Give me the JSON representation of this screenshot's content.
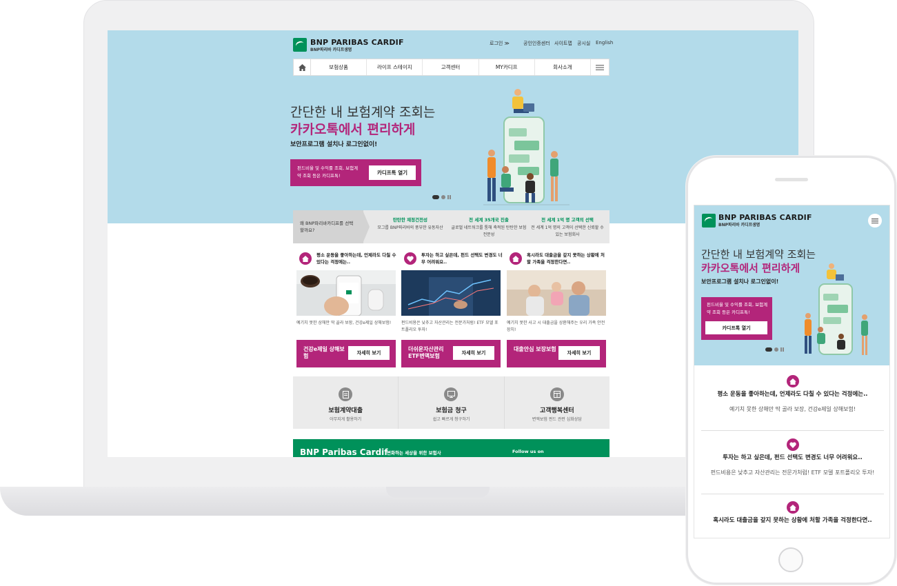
{
  "desktop": {
    "logo": {
      "main": "BNP PARIBAS CARDIF",
      "sub": "BNP파리바 카디프생명"
    },
    "util_links": [
      "로그인 ≫",
      "공인인증센터",
      "사이트맵",
      "공시실",
      "English"
    ],
    "nav": [
      "보험상품",
      "라이프 스테이지",
      "고객센터",
      "MY카디프",
      "회사소개"
    ],
    "hero": {
      "line1": "간단한 내 보험계약 조회는",
      "line2": "카카오톡에서 편리하게",
      "line3": "보안프로그램 설치나 로그인없이!",
      "promo_text": "펀드비율 및 수익률 조회, 보험계약 조회 등은 카디프톡!",
      "promo_button": "카디프톡 열기"
    },
    "why": {
      "lead": "왜 BNP파리바카디프를 선택할까요?",
      "cols": [
        {
          "title": "탄탄한 재정건전성",
          "desc": "모그룹 BNP파리바의 풍부한 유동자산"
        },
        {
          "title": "전 세계 35개국 진출",
          "desc": "글로벌 네트워크를 통해 축적된 탄탄한 보험 전문성"
        },
        {
          "title": "전 세계 1억 명 고객의 선택",
          "desc": "전 세계 1억 명의 고객이 선택한 신뢰할 수 있는 보험회사"
        }
      ]
    },
    "cards": [
      {
        "title": "평소 운동을 좋아하는데, 언제라도 다칠 수 있다는 걱정에는..",
        "desc": "예기치 못한 상해만 딱 골라 보장, 건강e제일 상해보험!",
        "product": "건강e제일 상해보험",
        "button": "자세히 보기"
      },
      {
        "title": "투자는 하고 싶은데, 펀드 선택도 변경도 너무 어려워요..",
        "desc": "펀드비용은 낮추고 자산관리는 전문가처럼! ETF 모델 포트폴리오 투자!",
        "product": "더쉬운자산관리 ETF변액보험",
        "button": "자세히 보기"
      },
      {
        "title": "혹시라도 대출금을 갚지 못하는 상황에 처할 가족을 걱정한다면..",
        "desc": "예기치 못한 사고 시 대출금을 상환해주는 우리 가족 안전장치!",
        "product": "대출안심 보장보험",
        "button": "자세히 보기"
      }
    ],
    "services": [
      {
        "title": "보험계약대출",
        "desc": "아무지게 활용하기"
      },
      {
        "title": "보험금 청구",
        "desc": "쉽고 빠르게 청구하기"
      },
      {
        "title": "고객행복센터",
        "desc": "변액보험 펀드 관련 심화상담"
      }
    ],
    "footer": {
      "brand": "BNP Paribas Cardif",
      "motto": "변화하는 세상을 위한 보험사",
      "follow": "Follow us on"
    }
  },
  "mobile": {
    "logo": {
      "main": "BNP PARIBAS CARDIF",
      "sub": "BNP파리바 카디프생명"
    },
    "hero": {
      "line1": "간단한 내 보험계약 조회는",
      "line2": "카카오톡에서 편리하게",
      "line3": "보안프로그램 설치나 로그인없이!",
      "promo_text": "펀드비율 및 수익률 조회, 보험계약 조회 등은 카디프톡!",
      "promo_button": "카디프톡 열기"
    },
    "items": [
      {
        "title": "평소 운동을 좋아하는데, 언제라도 다칠 수 있다는 걱정에는..",
        "desc": "예기치 못한 상해만 딱 골라 보장, 건강e제일 상해보험!"
      },
      {
        "title": "투자는 하고 싶은데, 펀드 선택도 변경도 너무 어려워요..",
        "desc": "펀드비용은 낮추고 자산관리는 전문가처럼! ETF 모델 포트폴리오 투자!"
      },
      {
        "title": "혹시라도 대출금을 갚지 못하는 상황에 처할 가족을 걱정한다면..",
        "desc": ""
      }
    ]
  },
  "colors": {
    "brand_green": "#00915a",
    "accent_magenta": "#b3257a",
    "hero_blue": "#b3dbea"
  }
}
